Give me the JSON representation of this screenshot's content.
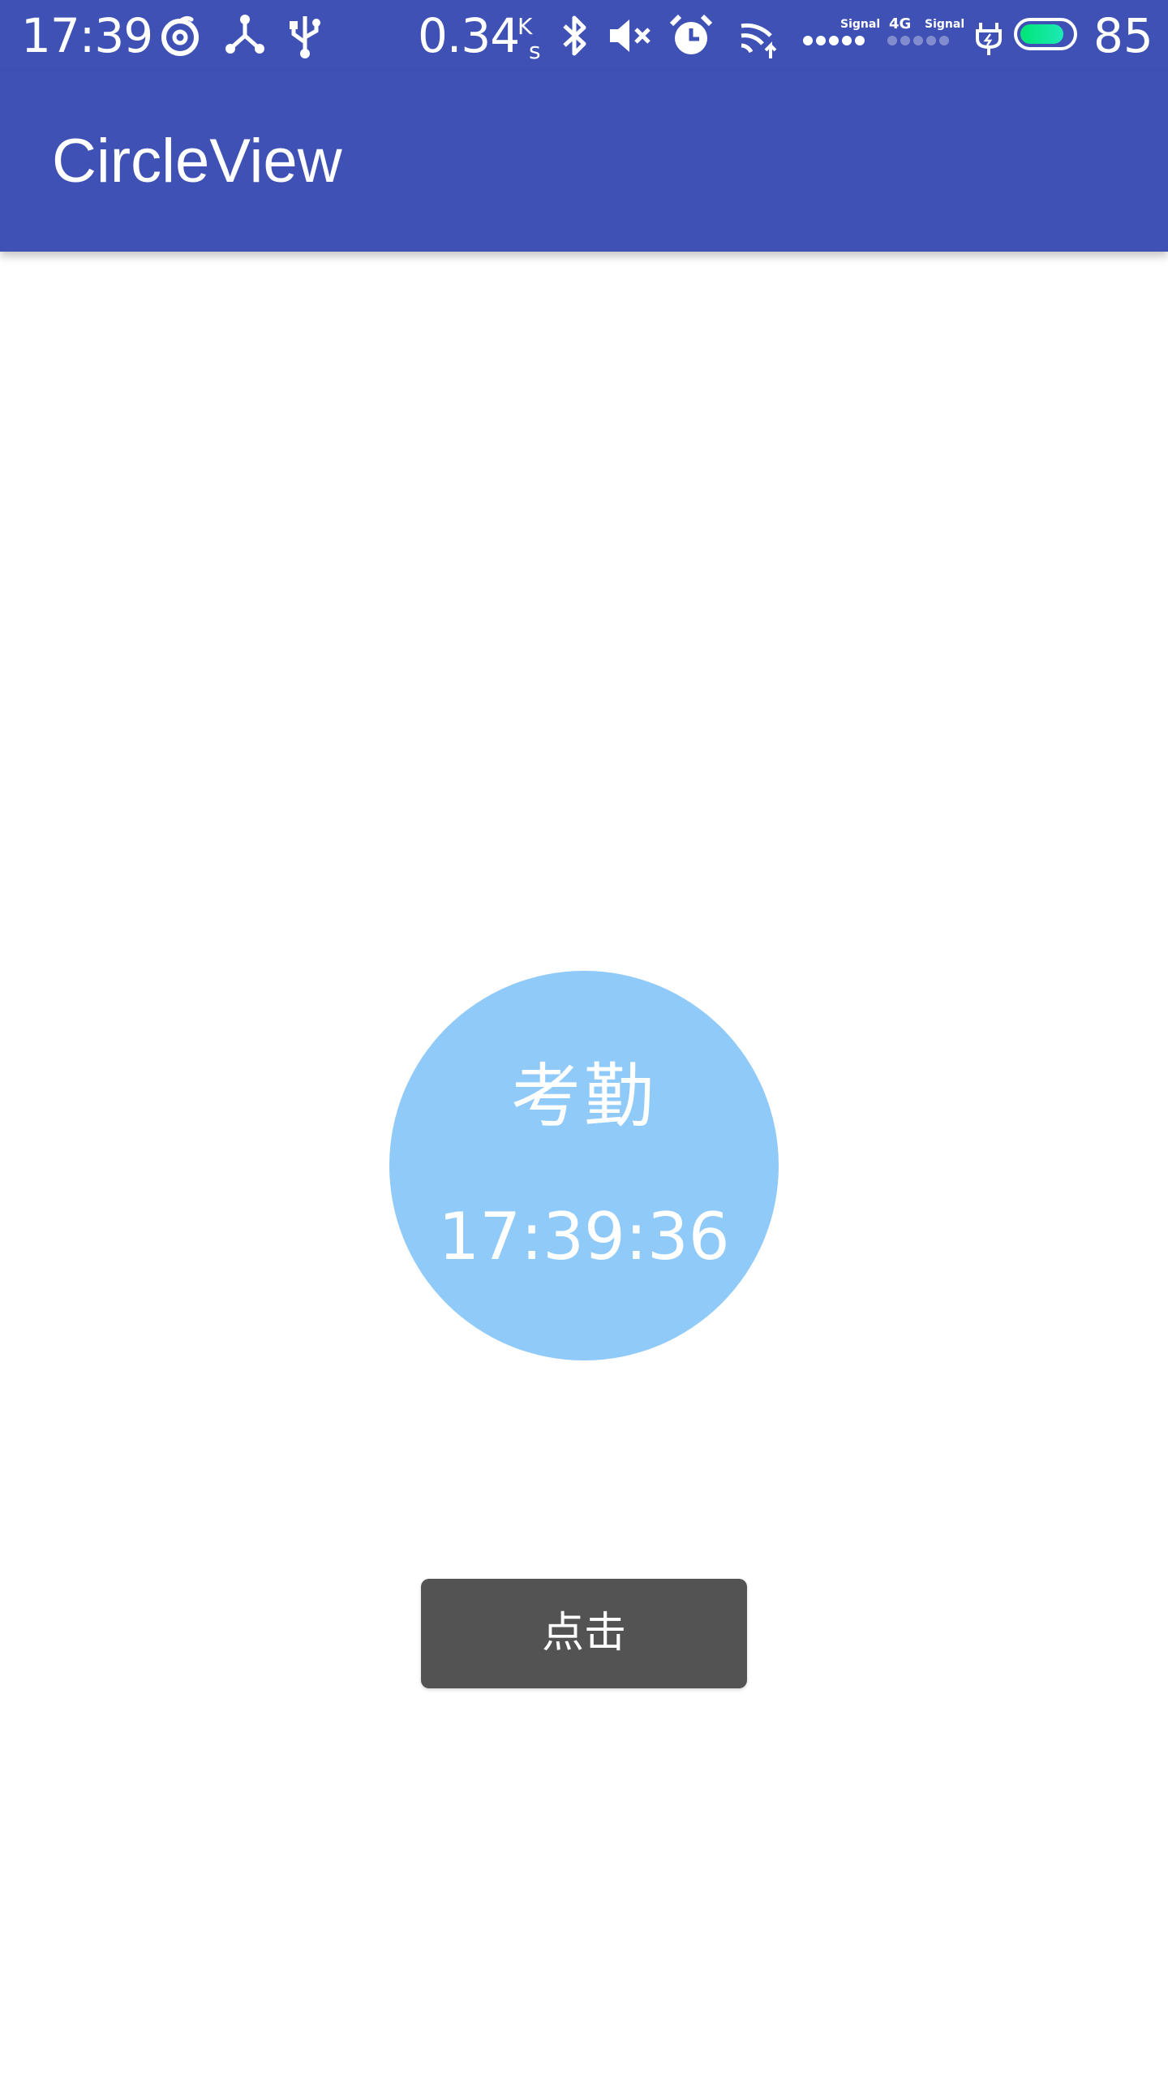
{
  "status_bar": {
    "time": "17:39",
    "net_speed": "0.34",
    "net_speed_unit_top": "K",
    "net_speed_unit_bottom": "s",
    "signal_1_label": "Signal",
    "network_type": "4G",
    "signal_2_label": "Signal",
    "battery_level": "85",
    "battery_fraction": 0.85,
    "icons": [
      "netease-music-icon",
      "share-hub-icon",
      "usb-icon",
      "bluetooth-icon",
      "mute-icon",
      "alarm-icon",
      "wifi-icon",
      "charging-plug-icon",
      "battery-icon"
    ]
  },
  "app_bar": {
    "title": "CircleView"
  },
  "circle": {
    "label": "考勤",
    "time": "17:39:36"
  },
  "button": {
    "label": "点击"
  },
  "colors": {
    "primary": "#3f51b5",
    "circle": "#90caf9",
    "button": "#535353",
    "background": "#ffffff"
  }
}
